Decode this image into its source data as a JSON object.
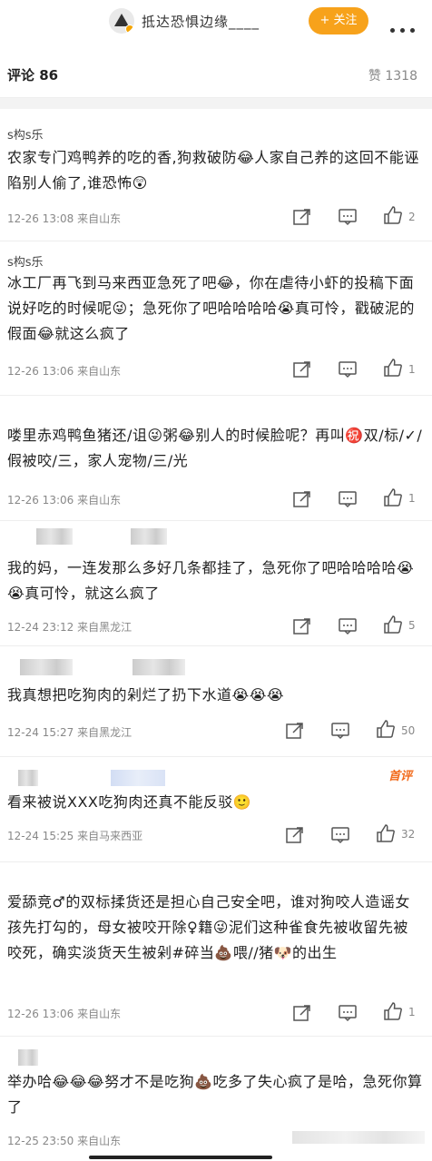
{
  "header": {
    "title": "抵达恐惧边缘____",
    "follow_label": "+ 关注"
  },
  "tabs": {
    "comments": "评论 86",
    "likes": "赞 1318"
  },
  "comments": [
    {
      "user": "s构s乐",
      "text": "农家专门鸡鸭养的吃的香,狗救破防😂人家自己养的这回不能诬陷别人偷了,谁恐怖😲",
      "meta": "12-26 13:08  来自山东",
      "likes": "2"
    },
    {
      "user": "s构s乐",
      "text": "冰工厂再飞到马来西亚急死了吧😂，你在虐待小虾的投稿下面说好吃的时候呢😜；急死你了吧哈哈哈哈😭真可怜，戳破泥的假面😂就这么疯了",
      "meta": "12-26 13:06  来自山东",
      "likes": "1"
    },
    {
      "user": "",
      "text": "喽里赤鸡鸭鱼猪还/诅😜粥😂别人的时候脸呢？再叫㊗️双/标/✓/假被咬/三，家人宠物/三/光",
      "meta": "12-26 13:06  来自山东",
      "likes": "1"
    },
    {
      "user": "",
      "text": "我的妈，一连发那么多好几条都挂了，急死你了吧哈哈哈哈😭😭真可怜，就这么疯了",
      "meta": "12-24 23:12  来自黑龙江",
      "likes": "5"
    },
    {
      "user": "",
      "text": "我真想把吃狗肉的剁烂了扔下水道😭😭😭",
      "meta": "12-24 15:27  来自黑龙江",
      "likes": "50"
    },
    {
      "user": "",
      "badge": "首评",
      "text": "看来被说XXX吃狗肉还真不能反驳🙂",
      "meta": "12-24 15:25  来自马来西亚",
      "likes": "32"
    },
    {
      "user": "",
      "text": "爱舔竞♂的双标揉货还是担心自己安全吧，谁对狗咬人造谣女孩先打勾的，母女被咬开除♀籍😜泥们这种雀食先被收留先被咬死，确实淡货天生被剁#碎当💩喂//猪🐶的出生",
      "meta": "12-26 13:06  来自山东",
      "likes": "1"
    },
    {
      "user": "",
      "text": "举办哈😂😂😂努才不是吃狗💩吃多了失心疯了是哈，急死你算了",
      "meta": "12-25 23:50  来自山东",
      "likes": ""
    }
  ],
  "colors": {
    "accent": "#f7a21b",
    "hot_badge": "#f26b1c",
    "meta_text": "#888888"
  }
}
